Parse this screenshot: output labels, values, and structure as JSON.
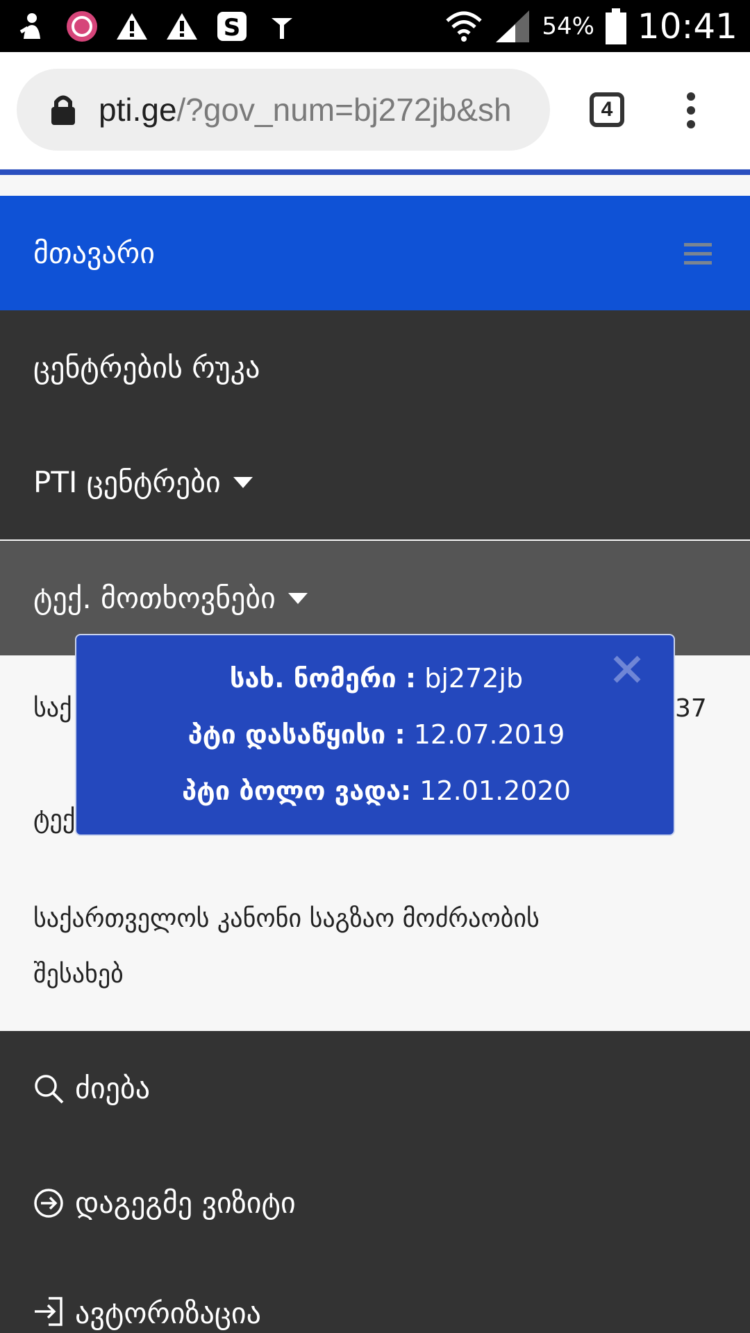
{
  "status_bar": {
    "battery": "54%",
    "time": "10:41",
    "icons": [
      "person-icon",
      "app-circle-icon",
      "warning-icon",
      "warning-icon",
      "skype-icon",
      "antenna-icon",
      "wifi-icon",
      "signal-icon",
      "battery-icon"
    ]
  },
  "browser": {
    "url_domain": "pti.ge",
    "url_rest": "/?gov_num=bj272jb&sh",
    "tab_count": "4"
  },
  "nav": {
    "brand": "მთავარი",
    "items": [
      {
        "label": "ცენტრების რუკა"
      },
      {
        "label": "PTI ცენტრები"
      },
      {
        "label": "ტექ. მოთხოვნები"
      }
    ],
    "dropdown": {
      "item1_start": "საქ",
      "item1_end": "37",
      "item2_start": "ტექ",
      "item3": "საქართველოს კანონი საგზაო მოძრაობის",
      "item3_line2": "შესახებ"
    },
    "search": "ძიება",
    "plan_visit": "დაგეგმე ვიზიტი",
    "login": "ავტორიზაცია"
  },
  "modal": {
    "plate_label": "სახ. ნომერი :",
    "plate_value": "bj272jb",
    "start_label": "პტი დასაწყისი :",
    "start_value": "12.07.2019",
    "end_label": "პტი ბოლო ვადა:",
    "end_value": "12.01.2020"
  },
  "colors": {
    "nav_blue": "#0f52d6",
    "modal_blue": "#2448bd",
    "dark_menu": "#333333",
    "active_menu": "#555555"
  }
}
